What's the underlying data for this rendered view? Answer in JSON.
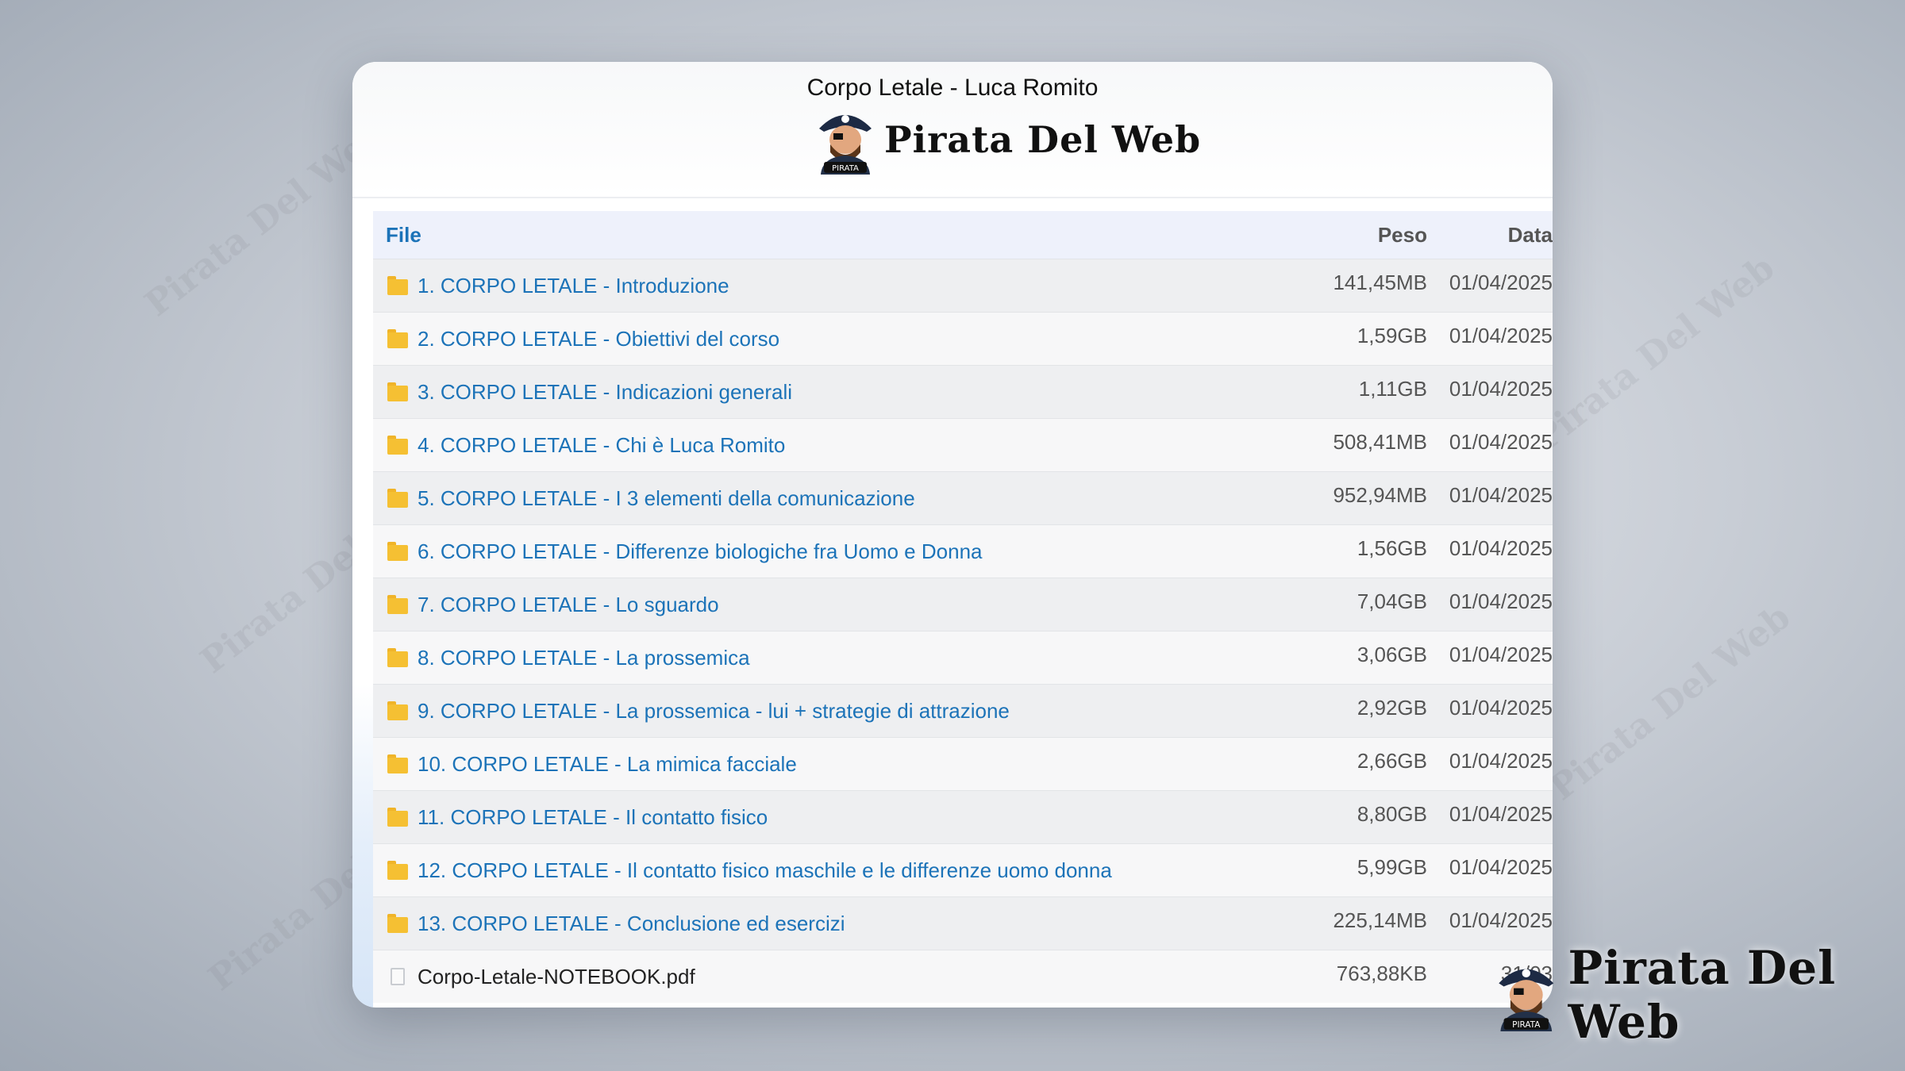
{
  "window": {
    "title": "Corpo Letale - Luca Romito",
    "brand": "Pirata Del Web",
    "avatar_badge": "PIRATA"
  },
  "table": {
    "headers": {
      "file": "File",
      "size": "Peso",
      "date": "Data"
    },
    "rows": [
      {
        "name": "1. CORPO LETALE - Introduzione",
        "size": "141,45MB",
        "date": "01/04/2025",
        "type": "folder-icon"
      },
      {
        "name": "2. CORPO LETALE - Obiettivi del corso",
        "size": "1,59GB",
        "date": "01/04/2025",
        "type": "folder-icon"
      },
      {
        "name": "3. CORPO LETALE - Indicazioni generali",
        "size": "1,11GB",
        "date": "01/04/2025",
        "type": "folder-icon"
      },
      {
        "name": "4. CORPO LETALE - Chi è Luca Romito",
        "size": "508,41MB",
        "date": "01/04/2025",
        "type": "folder-icon"
      },
      {
        "name": "5. CORPO LETALE - I 3 elementi della comunicazione",
        "size": "952,94MB",
        "date": "01/04/2025",
        "type": "folder-icon"
      },
      {
        "name": "6. CORPO LETALE - Differenze biologiche fra Uomo e Donna",
        "size": "1,56GB",
        "date": "01/04/2025",
        "type": "folder-icon"
      },
      {
        "name": "7. CORPO LETALE - Lo sguardo",
        "size": "7,04GB",
        "date": "01/04/2025",
        "type": "folder-icon"
      },
      {
        "name": "8. CORPO LETALE - La prossemica",
        "size": "3,06GB",
        "date": "01/04/2025",
        "type": "folder-icon"
      },
      {
        "name": "9. CORPO LETALE - La prossemica - lui + strategie di attrazione",
        "size": "2,92GB",
        "date": "01/04/2025",
        "type": "folder-icon"
      },
      {
        "name": "10. CORPO LETALE - La mimica facciale",
        "size": "2,66GB",
        "date": "01/04/2025",
        "type": "folder-icon"
      },
      {
        "name": "11. CORPO LETALE - Il contatto fisico",
        "size": "8,80GB",
        "date": "01/04/2025",
        "type": "folder-icon"
      },
      {
        "name": "12. CORPO LETALE - Il contatto fisico maschile e le differenze uomo donna",
        "size": "5,99GB",
        "date": "01/04/2025",
        "type": "folder-icon"
      },
      {
        "name": "13. CORPO LETALE - Conclusione ed esercizi",
        "size": "225,14MB",
        "date": "01/04/2025",
        "type": "folder-icon"
      },
      {
        "name": "Corpo-Letale-NOTEBOOK.pdf",
        "size": "763,88KB",
        "date": "31/03",
        "type": "file-icon"
      }
    ]
  },
  "watermark": {
    "text": "Pirata Del Web"
  },
  "colors": {
    "link": "#1c73b8",
    "folder": "#f5c033",
    "header_bg": "#eef1fb"
  }
}
